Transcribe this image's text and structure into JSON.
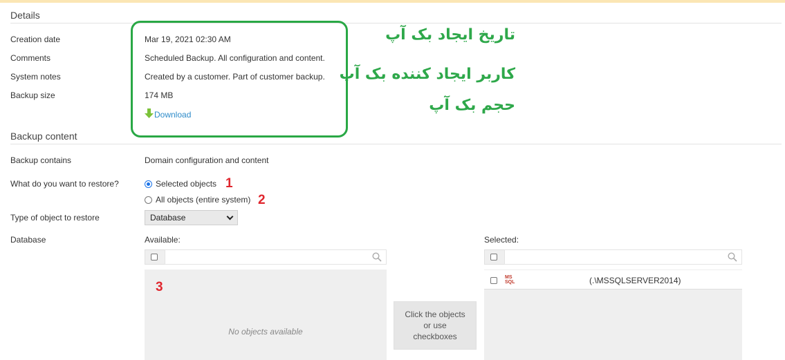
{
  "details": {
    "title": "Details",
    "creation_date_label": "Creation date",
    "creation_date": "Mar 19, 2021 02:30 AM",
    "comments_label": "Comments",
    "comments": "Scheduled Backup. All configuration and content.",
    "system_notes_label": "System notes",
    "system_notes": "Created by a customer. Part of customer backup.",
    "backup_size_label": "Backup size",
    "backup_size": "174 MB",
    "download_label": "Download"
  },
  "annotations": {
    "note_date": "تاریخ ایجاد بک آپ",
    "note_user": "کاربر ایجاد کننده بک آپ",
    "note_size": "حجم بک آپ",
    "marker_1": "1",
    "marker_2": "2",
    "marker_3": "3",
    "highlight_color": "#29a845",
    "marker_color": "#e0262e"
  },
  "backup_content": {
    "title": "Backup content",
    "contains_label": "Backup contains",
    "contains_value": "Domain configuration and content",
    "restore_label": "What do you want to restore?",
    "option_selected": "Selected objects",
    "option_all": "All objects (entire system)",
    "selected_option": "Selected objects",
    "type_label": "Type of object to restore",
    "type_value": "Database",
    "database_label": "Database",
    "available_label": "Available:",
    "selected_label": "Selected:",
    "empty_text": "No objects available",
    "move_hint": "Click the objects or use checkboxes",
    "selected_items": [
      {
        "badge": "MS SQL",
        "name": "(.\\MSSQLSERVER2014)"
      }
    ]
  },
  "icons": {
    "download": "arrow-down-icon",
    "search": "search-icon",
    "dropdown": "chevron-down-icon",
    "db_type": "mssql-icon"
  },
  "colors": {
    "link": "#2d8bc9",
    "accent": "#1a73e8",
    "download_icon": "#7cc23a"
  }
}
